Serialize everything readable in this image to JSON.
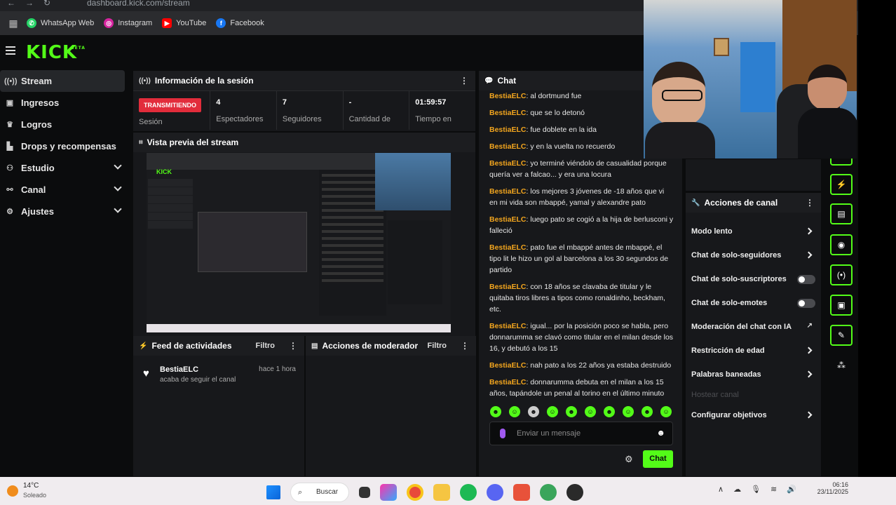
{
  "browser": {
    "url": "dashboard.kick.com/stream",
    "bookmarks": [
      {
        "label": "WhatsApp Web",
        "color": "#25d366",
        "icon": "whatsapp-icon"
      },
      {
        "label": "Instagram",
        "color": "#d6249f",
        "icon": "instagram-icon"
      },
      {
        "label": "YouTube",
        "color": "#ff0000",
        "icon": "youtube-icon"
      },
      {
        "label": "Facebook",
        "color": "#1877f2",
        "icon": "facebook-icon"
      }
    ]
  },
  "brand": {
    "logo": "KICK",
    "badge": "BETA",
    "accent": "#53fc18"
  },
  "sidebar": {
    "items": [
      {
        "label": "Stream",
        "icon": "stream-icon",
        "active": true
      },
      {
        "label": "Ingresos",
        "icon": "income-icon"
      },
      {
        "label": "Logros",
        "icon": "trophy-icon"
      },
      {
        "label": "Drops y recompensas",
        "icon": "drops-icon"
      },
      {
        "label": "Estudio",
        "icon": "studio-icon",
        "expandable": true
      },
      {
        "label": "Canal",
        "icon": "channel-icon",
        "expandable": true
      },
      {
        "label": "Ajustes",
        "icon": "settings-icon",
        "expandable": true
      }
    ]
  },
  "session": {
    "title": "Información de la sesión",
    "status": "TRANSMITIENDO",
    "status_label": "Sesión",
    "stats": [
      {
        "value": "4",
        "label": "Espectadores"
      },
      {
        "value": "7",
        "label": "Seguidores"
      },
      {
        "value": "-",
        "label": "Cantidad de"
      },
      {
        "value": "01:59:57",
        "label": "Tiempo en"
      }
    ]
  },
  "preview": {
    "title": "Vista previa del stream"
  },
  "activity": {
    "title": "Feed de actividades",
    "filter": "Filtro",
    "items": [
      {
        "user": "BestiaELC",
        "time": "hace 1 hora",
        "desc": "acaba de seguir el canal"
      }
    ]
  },
  "moderator": {
    "title": "Acciones de moderador",
    "filter": "Filtro"
  },
  "chat": {
    "title": "Chat",
    "messages": [
      {
        "user": "BestiaELC",
        "text": "al dortmund fue"
      },
      {
        "user": "BestiaELC",
        "text": "que se lo detonó"
      },
      {
        "user": "BestiaELC",
        "text": "fue doblete en la ida"
      },
      {
        "user": "BestiaELC",
        "text": "y en la vuelta no recuerdo"
      },
      {
        "user": "BestiaELC",
        "text": "yo terminé viéndolo de casualidad porque quería ver a falcao... y era una locura"
      },
      {
        "user": "BestiaELC",
        "text": "los mejores 3 jóvenes de -18 años que vi en mi vida son mbappé, yamal y alexandre pato"
      },
      {
        "user": "BestiaELC",
        "text": "luego pato se cogió a la hija de berlusconi y falleció"
      },
      {
        "user": "BestiaELC",
        "text": "pato fue el mbappé antes de mbappé, el tipo lit le hizo un gol al barcelona a los 30 segundos de partido"
      },
      {
        "user": "BestiaELC",
        "text": "con 18 años se clavaba de titular y le quitaba tiros libres a tipos como ronaldinho, beckham, etc."
      },
      {
        "user": "BestiaELC",
        "text": "igual... por la posición poco se habla, pero donnarumma se clavó como titular en el milan desde los 16, y debutó a los 15"
      },
      {
        "user": "BestiaELC",
        "text": "nah pato a los 22 años ya estaba destruido"
      },
      {
        "user": "BestiaELC",
        "text": "donnarumma debuta en el milan a los 15 años, tapándole un penal al torino en el último minuto"
      }
    ],
    "input_placeholder": "Enviar un mensaje",
    "send_label": "Chat"
  },
  "channel_actions": {
    "title": "Acciones de canal",
    "items": [
      {
        "label": "Modo lento",
        "kind": "arrow"
      },
      {
        "label": "Chat de solo-seguidores",
        "kind": "arrow"
      },
      {
        "label": "Chat de solo-suscriptores",
        "kind": "toggle"
      },
      {
        "label": "Chat de solo-emotes",
        "kind": "toggle"
      },
      {
        "label": "Moderación del chat con IA",
        "kind": "external"
      },
      {
        "label": "Restricción de edad",
        "kind": "arrow"
      },
      {
        "label": "Palabras baneadas",
        "kind": "arrow"
      },
      {
        "label": "Hostear canal",
        "kind": "disabled"
      },
      {
        "label": "Configurar objetivos",
        "kind": "arrow"
      }
    ]
  },
  "taskbar": {
    "temp": "14°C",
    "condition": "Soleado",
    "search": "Buscar",
    "time": "06:16",
    "date": "23/11/2025"
  }
}
